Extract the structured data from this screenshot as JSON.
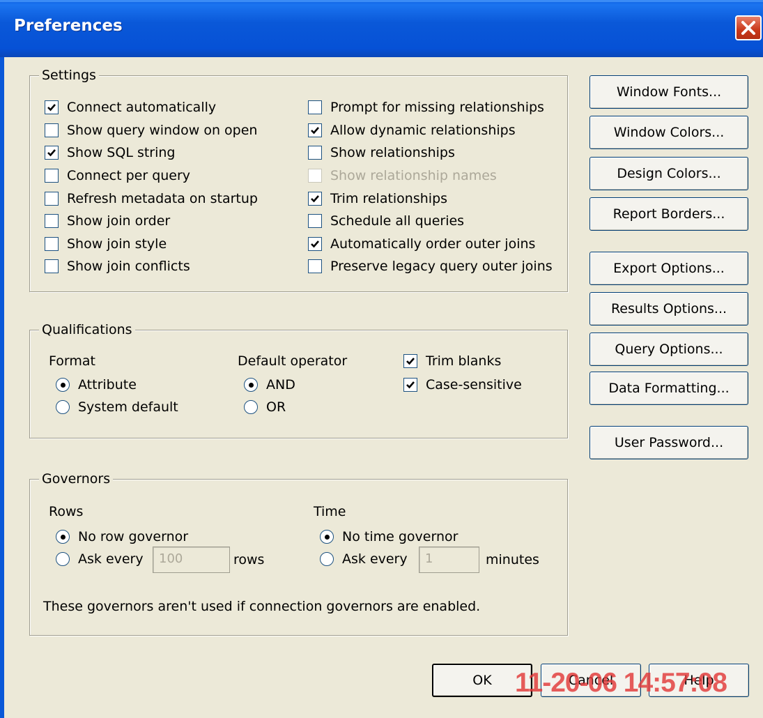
{
  "window": {
    "title": "Preferences"
  },
  "settings": {
    "label": "Settings",
    "left": [
      {
        "label": "Connect automatically",
        "checked": true
      },
      {
        "label": "Show query window on open",
        "checked": false
      },
      {
        "label": "Show SQL string",
        "checked": true
      },
      {
        "label": "Connect per query",
        "checked": false
      },
      {
        "label": "Refresh metadata on startup",
        "checked": false
      },
      {
        "label": "Show join order",
        "checked": false
      },
      {
        "label": "Show join style",
        "checked": false
      },
      {
        "label": "Show join conflicts",
        "checked": false
      }
    ],
    "right": [
      {
        "label": "Prompt for missing relationships",
        "checked": false
      },
      {
        "label": "Allow dynamic relationships",
        "checked": true
      },
      {
        "label": "Show relationships",
        "checked": false
      },
      {
        "label": "Show relationship names",
        "checked": false,
        "disabled": true
      },
      {
        "label": "Trim relationships",
        "checked": true
      },
      {
        "label": "Schedule all queries",
        "checked": false
      },
      {
        "label": "Automatically order outer joins",
        "checked": true
      },
      {
        "label": "Preserve legacy query outer joins",
        "checked": false
      }
    ]
  },
  "qualifications": {
    "label": "Qualifications",
    "format_label": "Format",
    "format_options": [
      {
        "label": "Attribute",
        "selected": true
      },
      {
        "label": "System default",
        "selected": false
      }
    ],
    "operator_label": "Default operator",
    "operator_options": [
      {
        "label": "AND",
        "selected": true
      },
      {
        "label": "OR",
        "selected": false
      }
    ],
    "trim_blanks": {
      "label": "Trim blanks",
      "checked": true
    },
    "case_sensitive": {
      "label": "Case-sensitive",
      "checked": true
    }
  },
  "governors": {
    "label": "Governors",
    "rows_label": "Rows",
    "no_row_governor": "No row governor",
    "ask_every": "Ask every",
    "rows_value": "100",
    "rows_unit": "rows",
    "time_label": "Time",
    "no_time_governor": "No time governor",
    "time_value": "1",
    "time_unit": "minutes",
    "note": "These governors aren't used if connection governors are enabled."
  },
  "side_buttons": [
    "Window Fonts...",
    "Window Colors...",
    "Design Colors...",
    "Report Borders...",
    "Export Options...",
    "Results Options...",
    "Query Options...",
    "Data Formatting...",
    "User Password..."
  ],
  "footer": {
    "ok": "OK",
    "cancel": "Cancel",
    "help": "Help"
  },
  "watermark": "11-20-06 14:57:08",
  "colors": {
    "titlebar": "#0a58d8",
    "dialog_bg": "#ece9d8",
    "watermark": "#e23a3a"
  }
}
